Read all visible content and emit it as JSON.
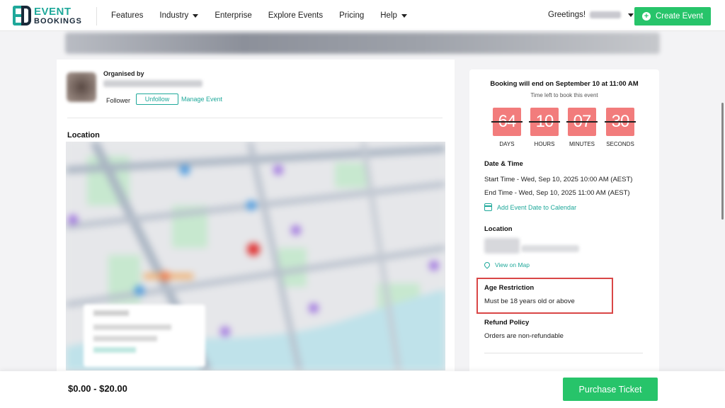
{
  "header": {
    "logo": {
      "line1": "EVENT",
      "line2": "BOOKINGS"
    },
    "nav": [
      {
        "label": "Features",
        "dropdown": false
      },
      {
        "label": "Industry",
        "dropdown": true
      },
      {
        "label": "Enterprise",
        "dropdown": false
      },
      {
        "label": "Explore Events",
        "dropdown": false
      },
      {
        "label": "Pricing",
        "dropdown": false
      },
      {
        "label": "Help",
        "dropdown": true
      }
    ],
    "greeting": "Greetings!",
    "create_button": "Create Event"
  },
  "organiser": {
    "label": "Organised by",
    "follower_label": "Follower",
    "unfollow_button": "Unfollow",
    "manage_link": "Manage Event"
  },
  "location_section": {
    "title": "Location"
  },
  "booking": {
    "end_text": "Booking will end on",
    "end_date": "September 10 at 11:00 AM",
    "time_left_label": "Time left to book this event",
    "countdown": [
      {
        "value": "64",
        "label": "DAYS"
      },
      {
        "value": "10",
        "label": "HOURS"
      },
      {
        "value": "07",
        "label": "MINUTES"
      },
      {
        "value": "30",
        "label": "SECONDS"
      }
    ]
  },
  "date_time": {
    "title": "Date & Time",
    "start": "Start Time - Wed, Sep 10, 2025 10:00 AM (AEST)",
    "end": "End Time - Wed, Sep 10, 2025 11:00 AM (AEST)",
    "calendar_link": "Add Event Date to Calendar"
  },
  "venue": {
    "title": "Location",
    "map_link": "View on Map"
  },
  "age_restriction": {
    "title": "Age Restriction",
    "text": "Must be 18 years old or above"
  },
  "refund": {
    "title": "Refund Policy",
    "text": "Orders are non-refundable"
  },
  "footer": {
    "price_range": "$0.00 - $20.00",
    "purchase_button": "Purchase Ticket"
  },
  "colors": {
    "accent": "#1fa89a",
    "green": "#27c46a",
    "countdown": "#f27c7c",
    "highlight": "#d94646"
  }
}
